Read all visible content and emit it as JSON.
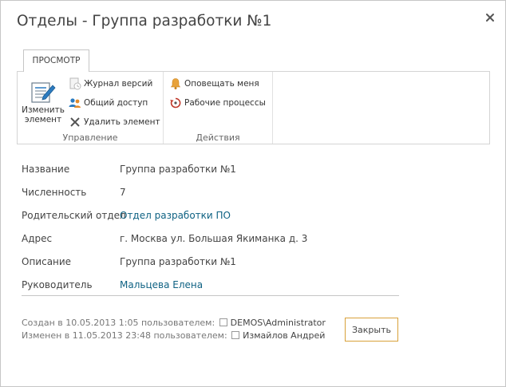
{
  "dialog": {
    "title": "Отделы - Группа разработки №1"
  },
  "ribbon": {
    "tab_label": "ПРОСМОТР",
    "groups": {
      "manage": {
        "label": "Управление",
        "edit_item": [
          "Изменить",
          "элемент"
        ],
        "version_history": "Журнал версий",
        "shared_with": "Общий доступ",
        "delete_item": "Удалить элемент"
      },
      "actions": {
        "label": "Действия",
        "alert_me": "Оповещать меня",
        "workflows": "Рабочие процессы"
      }
    }
  },
  "fields": [
    {
      "label": "Название",
      "value": "Группа разработки №1",
      "link": false
    },
    {
      "label": "Численность",
      "value": "7",
      "link": false
    },
    {
      "label": "Родительский отдел",
      "value": "Отдел разработки ПО",
      "link": true
    },
    {
      "label": "Адрес",
      "value": "г. Москва ул. Большая Якиманка д. 3",
      "link": false
    },
    {
      "label": "Описание",
      "value": "Группа разработки №1",
      "link": false
    },
    {
      "label": "Руководитель",
      "value": "Мальцева Елена",
      "link": true
    }
  ],
  "footer": {
    "created_prefix": "Создан в 10.05.2013 1:05 пользователем:",
    "created_user": "DEMOS\\Administrator",
    "modified_prefix": "Изменен в 11.05.2013 23:48 пользователем:",
    "modified_user": "Измайлов Андрей",
    "close_button": "Закрыть"
  },
  "colors": {
    "link": "#0f6283",
    "button_border": "#d8a13a",
    "border": "#c6c6c6"
  }
}
